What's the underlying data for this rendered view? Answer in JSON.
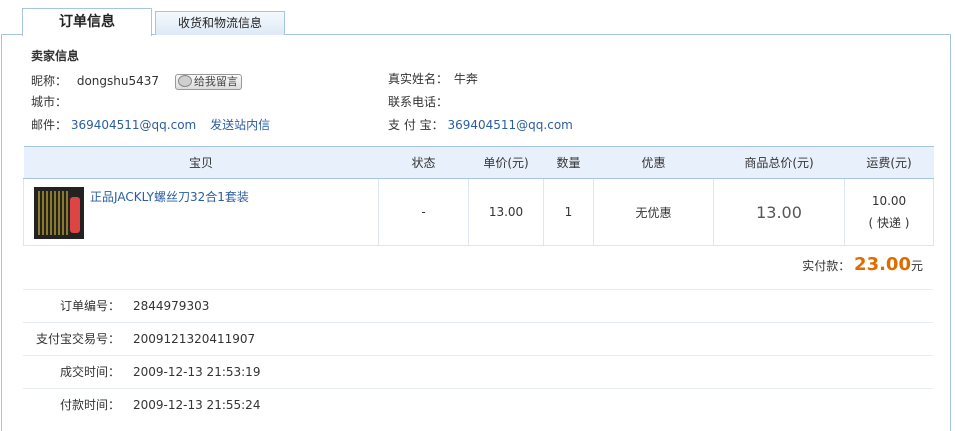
{
  "tabs": {
    "order_info": "订单信息",
    "shipping_info": "收货和物流信息"
  },
  "seller": {
    "title": "卖家信息",
    "nickname_label": "昵称：",
    "nickname": "dongshu5437",
    "message_button": "给我留言",
    "city_label": "城市：",
    "city": "",
    "email_label": "邮件：",
    "email": "369404511@qq.com",
    "send_message_link": "发送站内信",
    "realname_label": "真实姓名：",
    "realname": "牛奔",
    "phone_label": "联系电话：",
    "phone": "",
    "alipay_label": "支 付 宝：",
    "alipay": "369404511@qq.com"
  },
  "items_table": {
    "headers": [
      "宝贝",
      "状态",
      "单价(元)",
      "数量",
      "优惠",
      "商品总价(元)",
      "运费(元)"
    ],
    "rows": [
      {
        "title": "正品JACKLY螺丝刀32合1套装",
        "status": "-",
        "unit_price": "13.00",
        "quantity": "1",
        "discount": "无优惠",
        "total": "13.00",
        "shipping_fee": "10.00",
        "shipping_method": "( 快递 )"
      }
    ]
  },
  "payment": {
    "label": "实付款：",
    "amount": "23.00",
    "unit": "元"
  },
  "order_meta": [
    {
      "label": "订单编号：",
      "value": "2844979303"
    },
    {
      "label": "支付宝交易号：",
      "value": "2009121320411907"
    },
    {
      "label": "成交时间：",
      "value": "2009-12-13 21:53:19"
    },
    {
      "label": "付款时间：",
      "value": "2009-12-13 21:55:24"
    }
  ],
  "colors": {
    "link": "#2b5e9f",
    "accent_amount": "#e06c00",
    "border": "#a7c4e2",
    "header_bg": "#e8f1fb"
  }
}
